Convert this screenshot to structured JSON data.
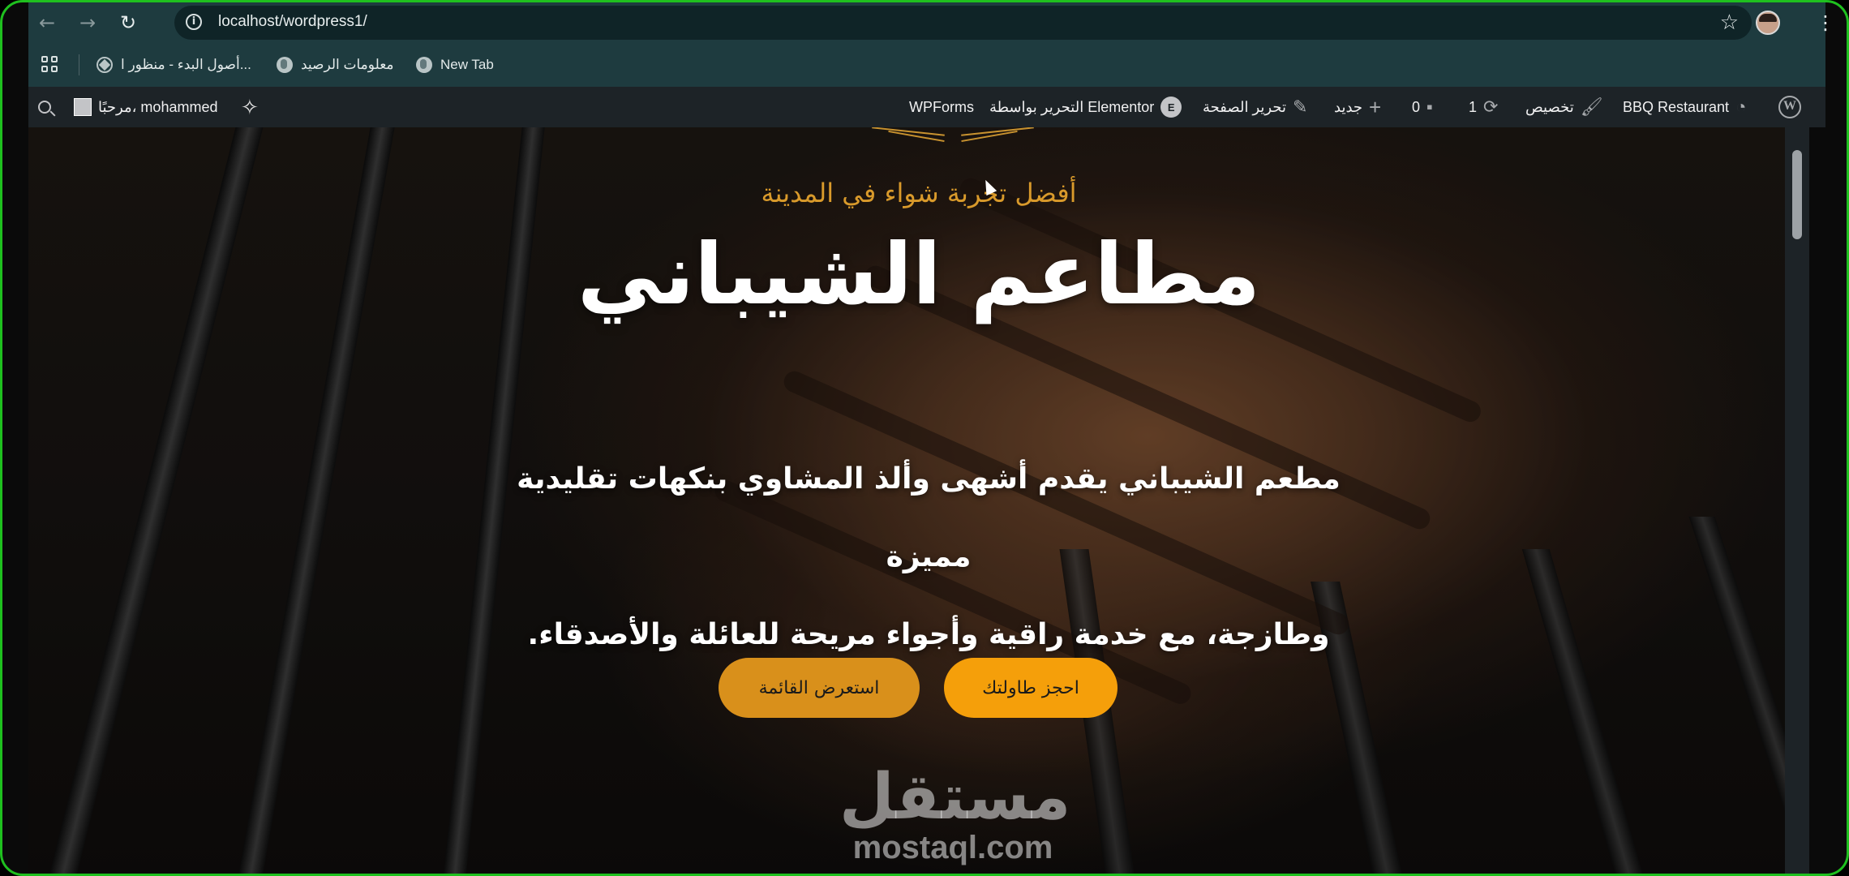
{
  "browser": {
    "url": "localhost/wordpress1/",
    "nav": {
      "back": "←",
      "forward": "→",
      "reload": "↻"
    },
    "star": "☆",
    "menu": "⋮"
  },
  "bookmarks": [
    {
      "label": "أصول البدء - منظور ا...",
      "icon": "wordpress-icon"
    },
    {
      "label": "معلومات الرصيد",
      "icon": "globe-icon"
    },
    {
      "label": "New Tab",
      "icon": "globe-icon"
    }
  ],
  "adminbar": {
    "site_name": "BBQ Restaurant",
    "customize": "تخصيص",
    "updates_count": "1",
    "comments_count": "0",
    "new": "جديد",
    "edit_page": "تحرير الصفحة",
    "edit_elementor": "التحرير بواسطة Elementor",
    "wpforms": "WPForms",
    "greeting": "مرحبًا، mohammed"
  },
  "hero": {
    "tagline": "أفضل تجربة شواء في المدينة",
    "headline": "مطاعم الشيباني",
    "description_line1": "مطعم الشيباني يقدم أشهى وألذ المشاوي بنكهات تقليدية مميزة",
    "description_line2": "وطازجة، مع خدمة راقية وأجواء مريحة للعائلة والأصدقاء.",
    "book_button": "احجز طاولتك",
    "menu_button": "استعرض القائمة"
  },
  "watermark": {
    "arabic": "مستقل",
    "latin": "mostaql.com"
  },
  "colors": {
    "accent": "#f59f0a",
    "tagline": "#d99a2b",
    "adminbar": "#1d2327",
    "browser_chrome": "#1e3b3f",
    "frame": "#1fc01f"
  }
}
